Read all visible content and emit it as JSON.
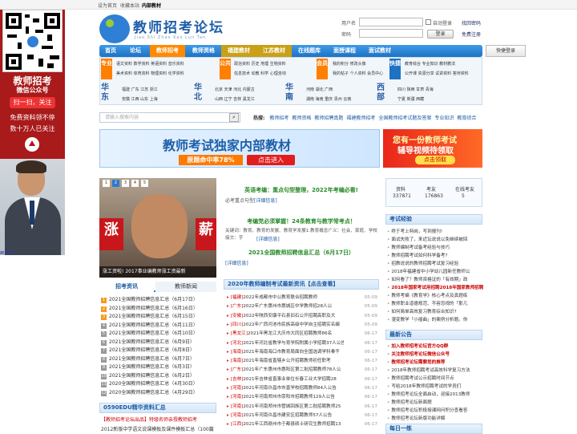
{
  "topbar": {
    "set_home": "设为首页",
    "add_favorite": "收藏本站",
    "internal": "内部教材"
  },
  "leftad": {
    "title1": "教师招考",
    "title2": "微信公众号",
    "scan": "扫一扫，关注",
    "line1": "免费资料领不停",
    "line2": "数十万人已关注",
    "close": "关闭"
  },
  "header": {
    "logo": "教师招考论坛",
    "logo_sub": "Jiao Shi Zhao Kao Lun Tan",
    "username_label": "用户名",
    "password_label": "密码",
    "auto_login": "自动登录",
    "find_password": "找回密码",
    "login": "登录",
    "register": "免费注册",
    "quick_login": "快捷登录"
  },
  "nav": [
    {
      "label": "首页"
    },
    {
      "label": "论坛"
    },
    {
      "label": "教师招考"
    },
    {
      "label": "教师资格"
    },
    {
      "label": "福建教材"
    },
    {
      "label": "江苏教材"
    },
    {
      "label": "在线题库"
    },
    {
      "label": "面授课程"
    },
    {
      "label": "面试教材"
    }
  ],
  "categories": {
    "b1": "专业",
    "r1": [
      "语文资料",
      "数学资料",
      "英语资料",
      "音乐资料"
    ],
    "r2": [
      "美术资料",
      "体育资料",
      "物理资料",
      "化学资料"
    ],
    "b2": "公共",
    "r3": [
      "政治资料",
      "历史",
      "地理",
      "生物资料"
    ],
    "r4": [
      "信息技术",
      "幼教",
      "科学",
      "心理咨询"
    ],
    "b3": "会员",
    "r5": [
      "我的积分",
      "修改头像"
    ],
    "r6": [
      "我的帖子",
      "个人资料"
    ],
    "r6b": [
      "会员中心"
    ],
    "b4": "快捷",
    "r7": [
      "教育综合",
      "专业知识",
      "教材教法"
    ],
    "r8": [
      "公开课",
      "资源分享",
      "试讲资料",
      "答辩资料"
    ],
    "regions": [
      {
        "name1": "华",
        "name2": "东",
        "row1": [
          "福建",
          "广东",
          "江苏",
          "浙江"
        ],
        "row2": [
          "安徽",
          "江西",
          "山东",
          "上海"
        ]
      },
      {
        "name1": "华",
        "name2": "北",
        "row1": [
          "北京",
          "天津",
          "河北",
          "内蒙古"
        ],
        "row2": [
          "山西",
          "辽宁",
          "吉林",
          "黑龙江"
        ]
      },
      {
        "name1": "华",
        "name2": "南",
        "row1": [
          "河南",
          "湖北",
          "广西"
        ],
        "row2": [
          "湖南",
          "海南",
          "重庆",
          "贵州",
          "云南"
        ]
      },
      {
        "name1": "西",
        "name2": "部",
        "row1": [
          "四川",
          "陕西",
          "甘肃",
          "青海"
        ],
        "row2": [
          "宁夏",
          "新疆",
          "西藏"
        ]
      }
    ]
  },
  "search": {
    "placeholder": "请输入搜索内容",
    "hot_label": "热搜:",
    "hot": [
      "教师招考",
      "教师资格",
      "教师招聘真题",
      "福建教师招考",
      "全国教师招考试题及答案",
      "专业知识",
      "教育综合"
    ]
  },
  "banners": {
    "b1_title": "教师考试独家内部教材",
    "b1_sub": "原题命中率78%",
    "b1_btn": "点击进入",
    "b2_title": "您有一份教师考试",
    "b2_sub": "辅导视频待领取",
    "b2_btn": "点击领取"
  },
  "slide": {
    "caption": "涨工资啦! 2017事业编教师涨工资最新",
    "nums": [
      "1",
      "2",
      "3",
      "4",
      "5"
    ]
  },
  "middle": {
    "h1": "英语考编：重点句型整理，2022年考编必看!",
    "h1_sub": "必考重点句型",
    "h1_link": "[详细信息]",
    "h2": "考编党必须掌握！24条教育与教学常考点！",
    "h2_body": "关键词：教育、教育的发展、教育学发展1.教育概念广义：社会、家庭、学校接文：字",
    "h2_link": "[详细信息]",
    "h3": "2021全国教师招聘信息汇总（6月17日）",
    "h3_link": "[详细信息]",
    "news_head": "2020年教师编制考试最新资讯【点击查看】",
    "news": [
      {
        "tag": "[福建]",
        "title": "2022年成都市中公教育联合招聘教师",
        "date": "05-09"
      },
      {
        "tag": "[广东]",
        "title": "2022年广东惠州市惠城区中学教师招28人公",
        "date": "05-09"
      },
      {
        "tag": "[安徽]",
        "title": "2022年陕西安康平石县旧石公开招聘高职及大",
        "date": "05-09"
      },
      {
        "tag": "[四川]",
        "title": "2022年广西河池市民族高级中学自主招聘实名编",
        "date": "05-09"
      },
      {
        "tag": "[黑龙江]",
        "title": "2021年黑龙江大庆市大同区招聘教师86名",
        "date": "06-17"
      },
      {
        "tag": "[河北]",
        "title": "2021年河北省教学与育学院附属小学招聘37人公告",
        "date": "06-17"
      },
      {
        "tag": "[海南]",
        "title": "2021年海南海口市教育局面向全国选调学科骨干",
        "date": "06-17"
      },
      {
        "tag": "[海南]",
        "title": "2021年海南省直辖乡公开招聘教师初任职考",
        "date": "06-17"
      },
      {
        "tag": "[广东]",
        "title": "2021年广东惠州市惠阳区第二批招聘教师78人公",
        "date": "06-17"
      },
      {
        "tag": "[吉林]",
        "title": "2021年吉林省直事业单位长春工业大学招聘28",
        "date": "06-17"
      },
      {
        "tag": "[河南]",
        "title": "2021年河南许昌市市直学校招聘教师84人公告",
        "date": "06-17"
      },
      {
        "tag": "[河南]",
        "title": "2021年河南郑州市荥阳市招聘教师129人公告",
        "date": "06-17"
      },
      {
        "tag": "[河南]",
        "title": "2021年河南郑州市管城回族区第二批招聘教师25",
        "date": "06-17"
      },
      {
        "tag": "[河南]",
        "title": "2021年河南许昌市建安区招聘教师57人公告",
        "date": "06-17"
      },
      {
        "tag": "[江西]",
        "title": "2021年江西赣州市于都县硕士研究生教师招聘13",
        "date": "06-17"
      }
    ]
  },
  "leftlist": {
    "tab1": "招考资讯",
    "tab2": "教师新闻",
    "items": [
      {
        "n": "1",
        "t": "2021全国教师招聘信息汇总（6月17日）"
      },
      {
        "n": "2",
        "t": "2021全国教师招聘信息汇总（6月16日）"
      },
      {
        "n": "3",
        "t": "2021全国教师招聘信息汇总（6月15日）"
      },
      {
        "n": "4",
        "t": "2021全国教师招聘信息汇总（6月11日）"
      },
      {
        "n": "5",
        "t": "2021全国教师招聘信息汇总（6月10日）"
      },
      {
        "n": "6",
        "t": "2021全国教师招聘信息汇总（6月9日）"
      },
      {
        "n": "7",
        "t": "2021全国教师招聘信息汇总（6月8日）"
      },
      {
        "n": "8",
        "t": "2021全国教师招聘信息汇总（6月7日）"
      },
      {
        "n": "9",
        "t": "2021全国教师招聘信息汇总（6月3日）"
      },
      {
        "n": "10",
        "t": "2021全国教师招聘信息汇总（6月2日）"
      },
      {
        "n": "11",
        "t": "2020全国教师招聘信息汇总（4月30日）"
      },
      {
        "n": "12",
        "t": "2020全国教师招聘信息汇总（4月29日）"
      }
    ],
    "sec2": "0590EDU精华资料汇总",
    "sec2_items": [
      "【教师招考论坛出品】特级名师亲授教师招考",
      "2012新版中学语文说课模板及课件模板汇总（100篇"
    ]
  },
  "stats": {
    "l1": "资料",
    "l2": "考友",
    "l3": "在线考友",
    "v1": "337871",
    "v2": "176863",
    "v3": "5"
  },
  "right": {
    "sec1": "考试经验",
    "items1": [
      "终于考上特岗，写到报刊!",
      "面试失败了，来近坛说说以免继续被回",
      "教师编制考试备考经验与技巧",
      "教师招聘考试如何科学备考?",
      "招教说说的教师招聘考试复习经验",
      "2018年福建省中小学幼儿园新任教师公",
      "如何看了？教师资格证的「有效期」政",
      "2018年国家考试用招聘2018年国家教师招聘",
      "教师考编《教育学》核心考点及真题练",
      "教师职业道德规范、不容忽视的「那几",
      "如何简单高效复习教育综合知识?",
      "漫变教学「小插曲」的案例分析题。你"
    ],
    "sec2": "最新公告",
    "items2": [
      {
        "t": "加入教师招考论坛官方QQ群",
        "red": true
      },
      {
        "t": "关注教师招考论坛微信公众号",
        "red": true
      },
      {
        "t": "教师招考论坛需要您的推荐",
        "red": true
      },
      {
        "t": "2018年教师招聘考试高效科学复习方法",
        "red": false
      },
      {
        "t": "教师招聘考试公示招聘时间节点",
        "red": false
      },
      {
        "t": "写给2018年教师招聘考试的学员们",
        "red": false
      },
      {
        "t": "教师招考论坛全面启动，迎接2013教师",
        "red": false
      },
      {
        "t": "教师招考论坛新面貌",
        "red": false
      },
      {
        "t": "教师招考论坛积极授课网问积分查看答",
        "red": false
      },
      {
        "t": "教师招考论坛新版功能详解",
        "red": false
      }
    ],
    "sec3": "每日一练"
  },
  "colors": {
    "nav": "#1e72c4",
    "nav_active": "#ff8a00",
    "accent_red": "#c00",
    "ad_bg": "#a91a1a"
  }
}
